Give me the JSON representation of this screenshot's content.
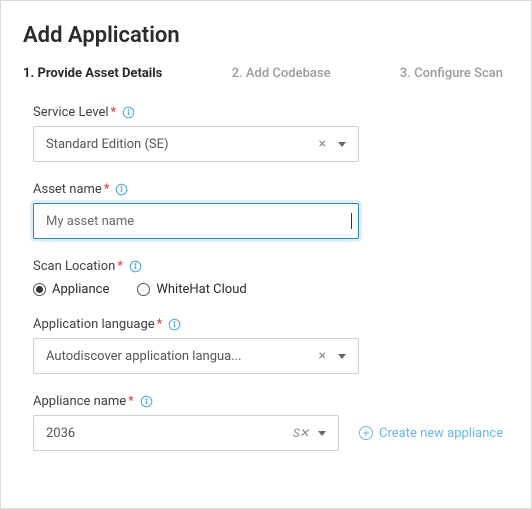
{
  "title": "Add Application",
  "stepper": {
    "step1": "1. Provide Asset Details",
    "step2": "2. Add Codebase",
    "step3": "3. Configure Scan"
  },
  "fields": {
    "service_level": {
      "label": "Service Level",
      "value": "Standard Edition (SE)"
    },
    "asset_name": {
      "label": "Asset name",
      "value": "My asset name"
    },
    "scan_location": {
      "label": "Scan Location",
      "options": {
        "appliance": "Appliance",
        "whitehat": "WhiteHat Cloud"
      },
      "selected": "appliance"
    },
    "app_language": {
      "label": "Application language",
      "value": "Autodiscover application langua..."
    },
    "appliance_name": {
      "label": "Appliance name",
      "value": "2036"
    }
  },
  "actions": {
    "create_appliance": "Create new appliance"
  }
}
